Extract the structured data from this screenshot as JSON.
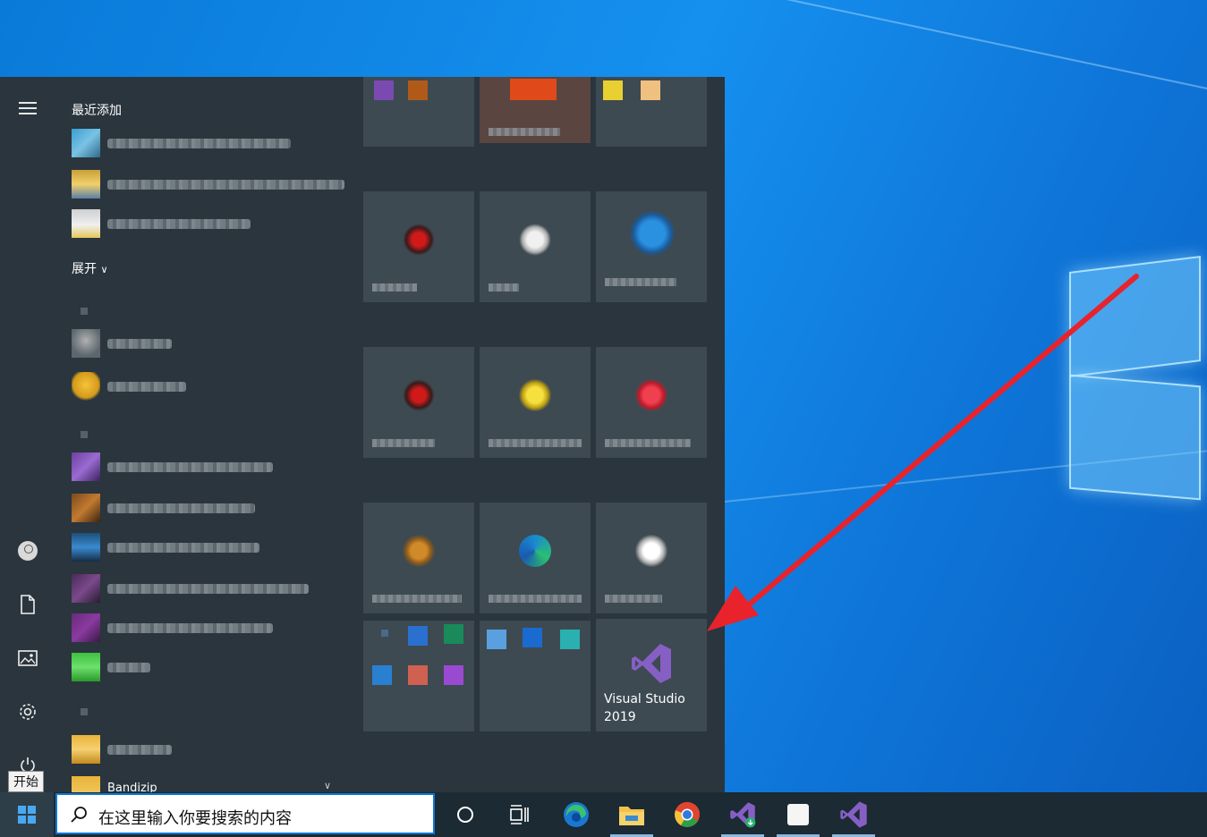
{
  "start_menu": {
    "recently_added_label": "最近添加",
    "expand_label": "展开",
    "pinned_tile_label": "Visual Studio 2019",
    "tile_icon": "visual-studio-icon",
    "partial_app_label": "Bandizip"
  },
  "rail": {
    "icons": [
      "hamburger-menu-icon",
      "user-account-icon",
      "documents-icon",
      "pictures-icon",
      "settings-gear-icon",
      "power-icon"
    ],
    "tooltip": "开始"
  },
  "taskbar": {
    "search_placeholder": "在这里输入你要搜索的内容",
    "items": [
      "cortana-icon",
      "task-view-icon",
      "edge-icon",
      "file-explorer-icon",
      "chrome-icon",
      "visual-studio-installer-icon",
      "notes-app-icon",
      "visual-studio-icon"
    ]
  },
  "annotation": {
    "arrow_color": "#e8232b"
  },
  "colors": {
    "accent": "#0a78d4",
    "menu_bg": "#2a353d",
    "tile_bg": "#3d4a52",
    "vs_purple": "#865fc5"
  }
}
